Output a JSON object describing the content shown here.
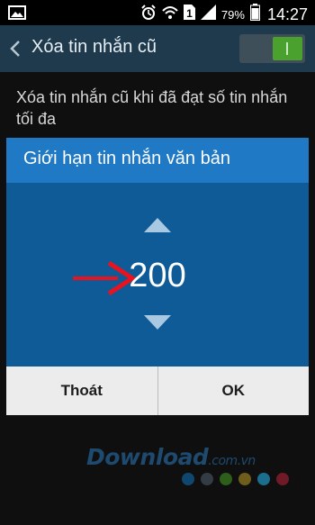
{
  "status_bar": {
    "battery": "79%",
    "time": "14:27",
    "sim_slot": "1",
    "icons": [
      "image-icon",
      "alarm-icon",
      "wifi-icon",
      "sim-icon",
      "signal-icon",
      "battery-icon"
    ]
  },
  "action_bar": {
    "title": "Xóa tin nhắn cũ",
    "toggle_on": true
  },
  "setting": {
    "description": "Xóa tin nhắn cũ khi đã đạt số tin nhắn tối đa"
  },
  "dialog": {
    "title": "Giới hạn tin nhắn văn bản",
    "value": "200",
    "cancel_label": "Thoát",
    "ok_label": "OK"
  },
  "watermark": {
    "brand": "Download",
    "domain": ".com.vn",
    "dot_colors": [
      "#10476f",
      "#333b44",
      "#2d5e1c",
      "#6f5d1c",
      "#1b6f8e",
      "#6f1a26"
    ]
  },
  "colors": {
    "action_bar": "#1f3a4d",
    "dialog_title": "#1f79c4",
    "dialog_body": "#0e5b97",
    "toggle_on": "#4aa12e",
    "annotation_arrow": "#e8131f"
  }
}
